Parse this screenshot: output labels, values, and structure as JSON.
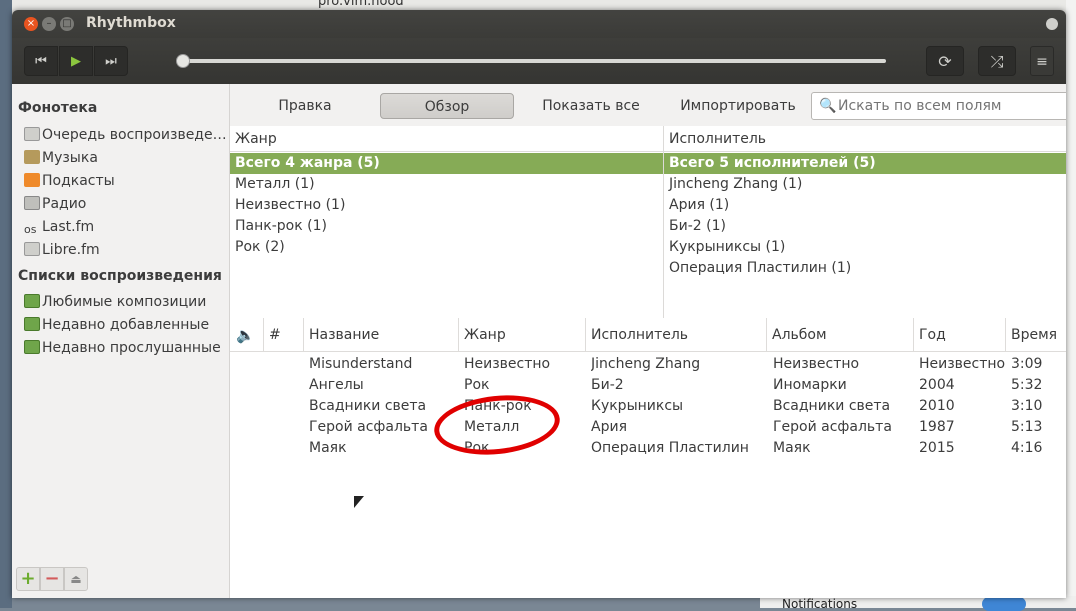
{
  "background": {
    "top_peek_text": "pro.vim.nood",
    "notifications_label": "Notifications"
  },
  "window": {
    "title": "Rhythmbox",
    "close_glyph": "×",
    "min_glyph": "–",
    "max_glyph": "□"
  },
  "toolbar": {
    "prev_glyph": "⏮",
    "play_glyph": "▶",
    "next_glyph": "⏭",
    "repeat_glyph": "⟳",
    "shuffle_glyph": "⤮",
    "menu_glyph": "≡",
    "seek_position": 0
  },
  "sidebar": {
    "library_heading": "Фонотека",
    "library_items": [
      {
        "label": "Очередь воспроизведе…",
        "icon": "queue-icon"
      },
      {
        "label": "Музыка",
        "icon": "music-icon"
      },
      {
        "label": "Подкасты",
        "icon": "podcast-icon"
      },
      {
        "label": "Радио",
        "icon": "radio-icon"
      },
      {
        "label": "Last.fm",
        "icon": "lastfm-icon"
      },
      {
        "label": "Libre.fm",
        "icon": "librefm-icon"
      }
    ],
    "playlists_heading": "Списки воспроизведения",
    "playlist_items": [
      {
        "label": "Любимые композиции",
        "icon": "playlist-icon"
      },
      {
        "label": "Недавно добавленные",
        "icon": "playlist-icon"
      },
      {
        "label": "Недавно прослушанные",
        "icon": "playlist-icon"
      }
    ],
    "add_glyph": "+",
    "remove_glyph": "−",
    "eject_glyph": "⏏"
  },
  "browse_bar": {
    "edit_label": "Правка",
    "browse_label": "Обзор",
    "show_all_label": "Показать все",
    "import_label": "Импортировать",
    "search_placeholder": "Искать по всем полям",
    "search_icon": "🔍"
  },
  "genre_pane": {
    "header": "Жанр",
    "rows": [
      "Всего 4 жанра (5)",
      "Металл (1)",
      "Неизвестно (1)",
      "Панк-рок (1)",
      "Рок (2)"
    ],
    "selected_index": 0
  },
  "artist_pane": {
    "header": "Исполнитель",
    "rows": [
      "Всего 5 исполнителей (5)",
      "Jincheng Zhang (1)",
      "Ария (1)",
      "Би-2 (1)",
      "Кукрыниксы (1)",
      "Операция Пластилин (1)"
    ],
    "selected_index": 0
  },
  "track_table": {
    "speaker_glyph": "🔈",
    "headers": {
      "num": "#",
      "title": "Название",
      "genre": "Жанр",
      "artist": "Исполнитель",
      "album": "Альбом",
      "year": "Год",
      "time": "Время"
    },
    "rows": [
      {
        "title": "Misunderstand",
        "genre": "Неизвестно",
        "artist": "Jincheng Zhang",
        "album": "Неизвестно",
        "year": "Неизвестно",
        "time": "3:09"
      },
      {
        "title": "Ангелы",
        "genre": "Рок",
        "artist": "Би-2",
        "album": "Иномарки",
        "year": "2004",
        "time": "5:32"
      },
      {
        "title": "Всадники света",
        "genre": "Панк-рок",
        "artist": "Кукрыниксы",
        "album": "Всадники света",
        "year": "2010",
        "time": "3:10"
      },
      {
        "title": "Герой асфальта",
        "genre": "Металл",
        "artist": "Ария",
        "album": "Герой асфальта",
        "year": "1987",
        "time": "5:13"
      },
      {
        "title": "Маяк",
        "genre": "Рок",
        "artist": "Операция Пластилин",
        "album": "Маяк",
        "year": "2015",
        "time": "4:16"
      }
    ]
  },
  "colors": {
    "selection": "#86ab56",
    "annotation": "#e00000",
    "close_button": "#e95420"
  }
}
